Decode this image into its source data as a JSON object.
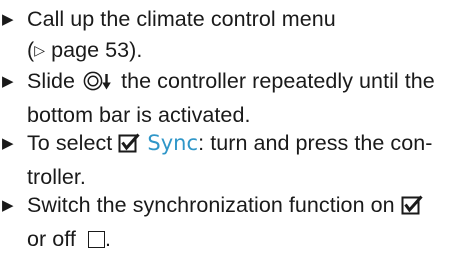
{
  "steps": [
    {
      "lines": [
        "Call up the climate control menu",
        [
          "(",
          "▷",
          " page 53)."
        ]
      ]
    },
    {
      "line1": [
        "Slide ",
        " the controller repeatedly until the"
      ],
      "line2": "bottom bar is activated."
    },
    {
      "line1": [
        "To select ",
        "Sync",
        ": turn and press the con-"
      ],
      "line2": "troller."
    },
    {
      "line1": "Switch the synchronization function on ",
      "line2": "or off ",
      "line2_end": "."
    }
  ],
  "bullet": "▶",
  "colors": {
    "text": "#1a1a1a",
    "accent": "#2f96c8"
  },
  "icons": [
    "bullet-triangle-icon",
    "controller-slide-down-icon",
    "checked-checkbox-icon",
    "empty-checkbox-icon"
  ]
}
